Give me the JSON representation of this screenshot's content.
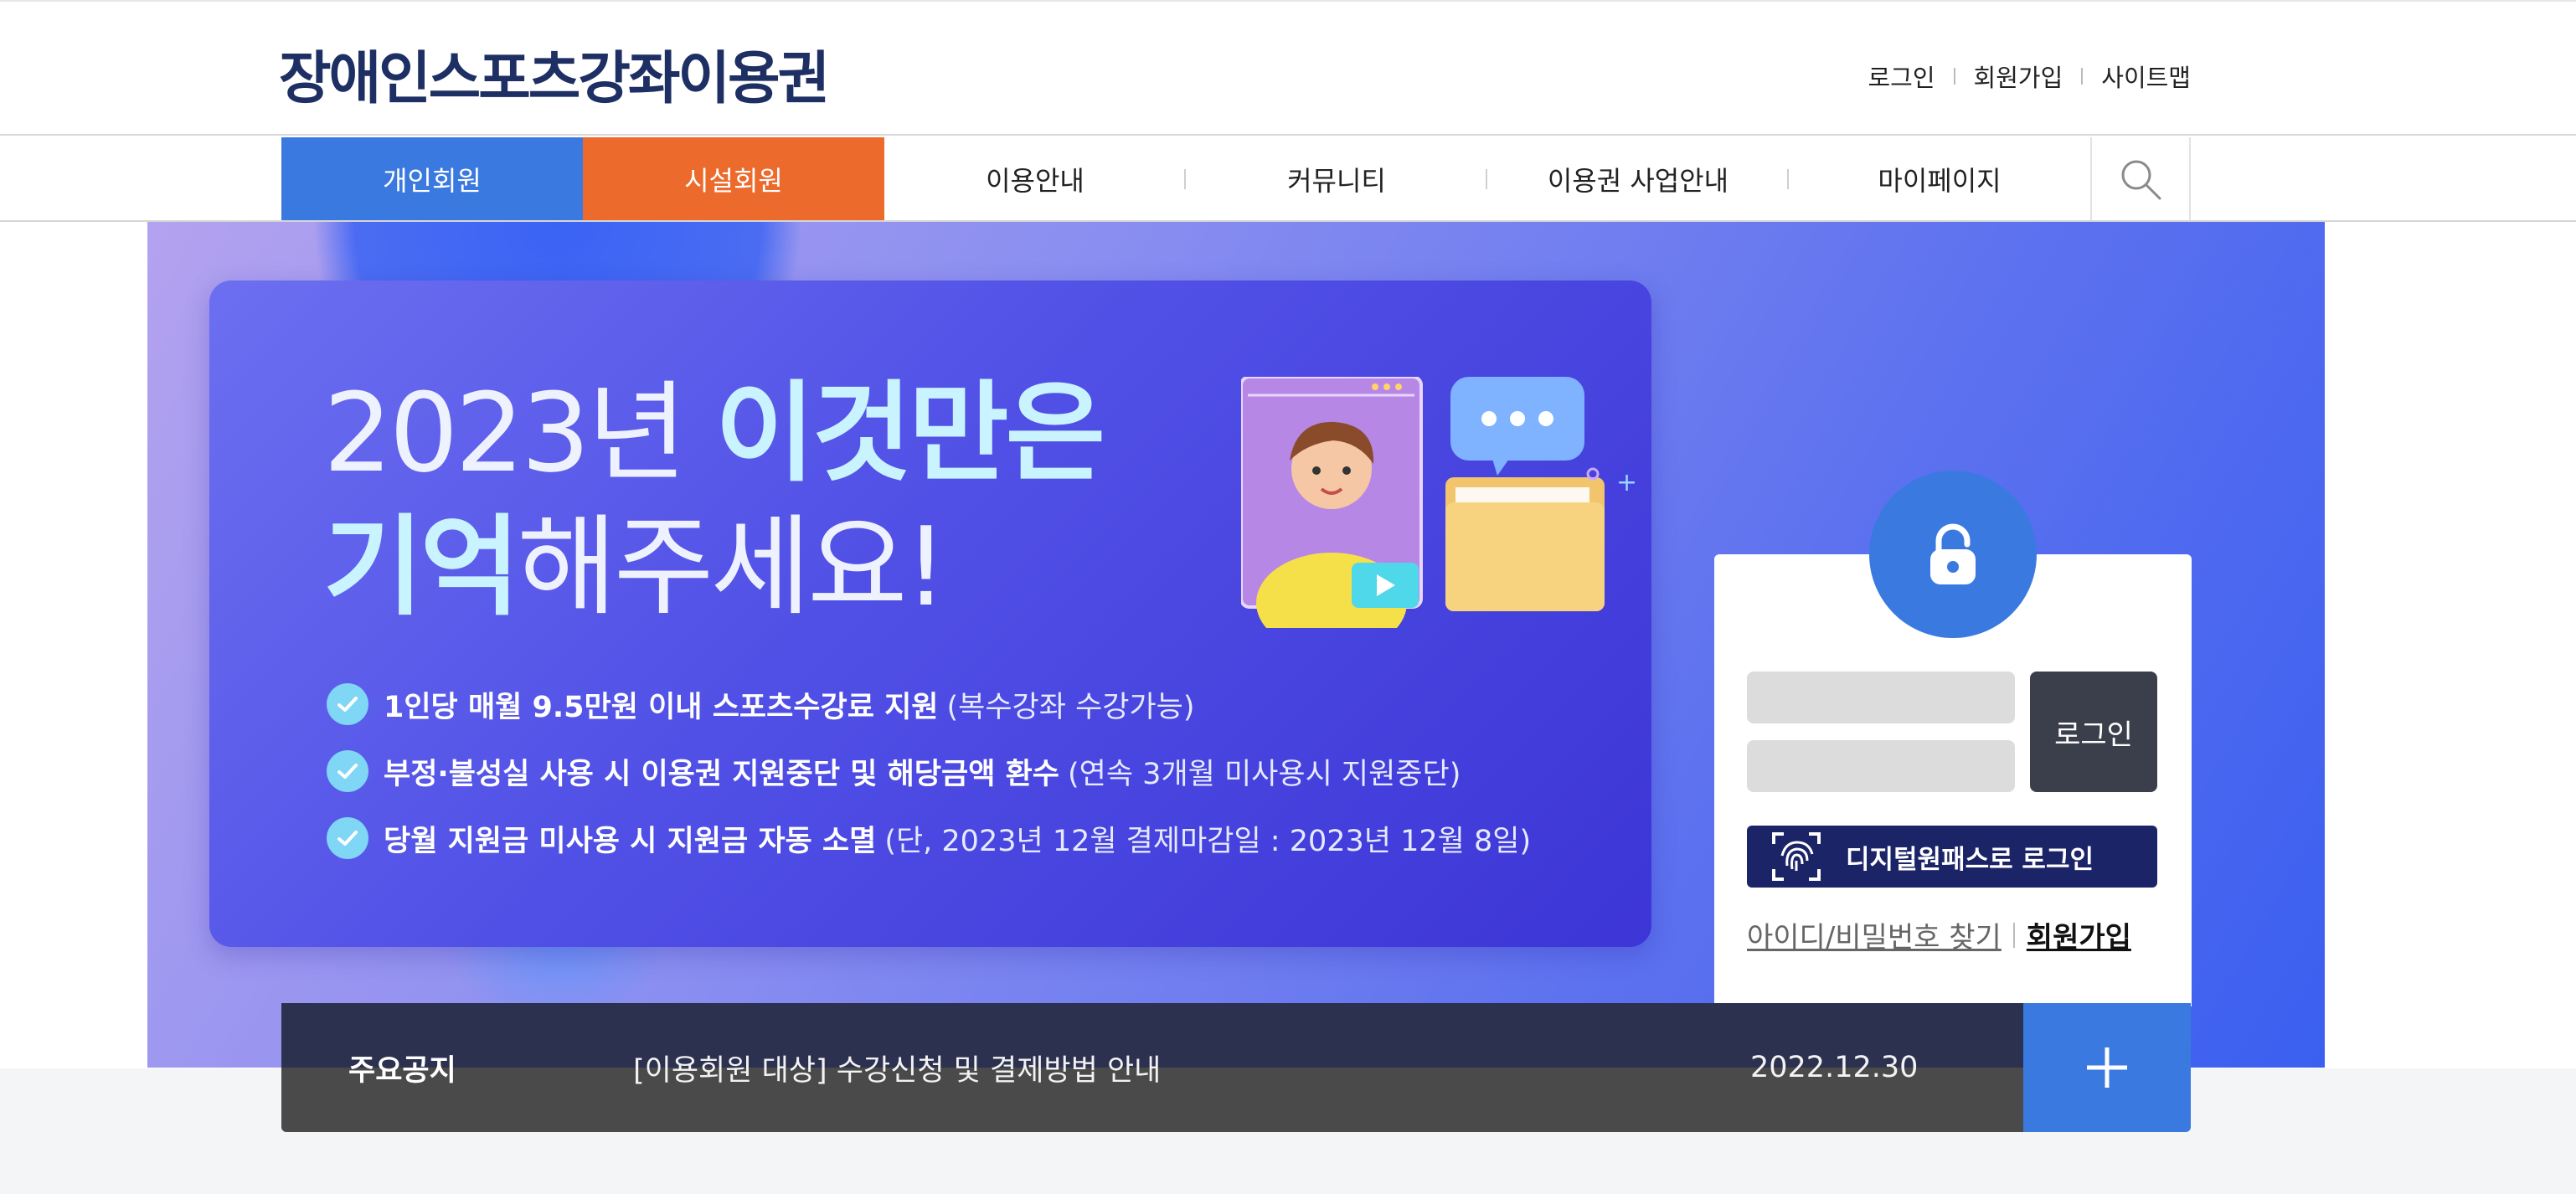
{
  "header": {
    "logo": "장애인스포츠강좌이용권",
    "util_links": [
      "로그인",
      "회원가입",
      "사이트맵"
    ]
  },
  "nav": {
    "primary": [
      "개인회원",
      "시설회원"
    ],
    "menu": [
      "이용안내",
      "커뮤니티",
      "이용권 사업안내",
      "마이페이지"
    ],
    "search_icon": "search-icon"
  },
  "banner": {
    "title_year": "2023년 ",
    "title_bold1": "이것만은",
    "title_bold2": "기억",
    "title_rest": "해주세요!",
    "checks": [
      {
        "bold": "1인당 매월 9.5만원 이내 스포츠수강료 지원",
        "note": "(복수강좌 수강가능)"
      },
      {
        "bold": "부정·불성실 사용 시 이용권 지원중단 및 해당금액 환수",
        "note": "(연속 3개월 미사용시 지원중단)"
      },
      {
        "bold": "당월 지원금 미사용 시 지원금 자동 소멸",
        "note": "(단, 2023년 12월 결제마감일 : 2023년 12월 8일)"
      }
    ]
  },
  "login": {
    "button": "로그인",
    "onepass": "디지털원패스로 로그인",
    "find": "아이디/비밀번호 찾기",
    "join": "회원가입",
    "lock_icon": "lock-icon"
  },
  "notice": {
    "label": "주요공지",
    "text": "[이용회원 대상] 수강신청 및 결제방법 안내",
    "date": "2022.12.30",
    "plus_icon": "plus-icon"
  },
  "colors": {
    "navy": "#1d2f63",
    "blue": "#3a7ae0",
    "orange": "#ec6a2c",
    "dark": "#2d3150",
    "onepass": "#1c2468"
  }
}
